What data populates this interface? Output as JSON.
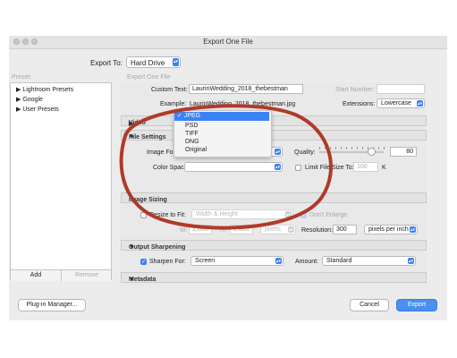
{
  "window": {
    "title": "Export One File"
  },
  "export_to": {
    "label": "Export To:",
    "value": "Hard Drive"
  },
  "presets": {
    "header": "Preset:",
    "items": [
      "Lightroom Presets",
      "Google",
      "User Presets"
    ],
    "add_label": "Add",
    "remove_label": "Remove"
  },
  "export_one_file_header": "Export One File",
  "custom_text": {
    "label": "Custom Text:",
    "value": "LaurinWedding_2018_thebestman"
  },
  "start_number": {
    "label": "Start Number:"
  },
  "example": {
    "label": "Example:",
    "value": "LaurinWedding_2018_thebestman.jpg"
  },
  "extensions": {
    "label": "Extensions:",
    "value": "Lowercase"
  },
  "sections": {
    "video": "Video",
    "file_settings": "File Settings",
    "image_sizing": "Image Sizing",
    "output_sharpening": "Output Sharpening",
    "metadata": "Metadata"
  },
  "file_settings": {
    "image_format_label": "Image Format:",
    "color_space_label": "Color Space:",
    "quality_label": "Quality:",
    "quality_value": "80",
    "quality_fraction": 0.8,
    "limit_file_size_label": "Limit File Size To:",
    "limit_file_size_value": "100",
    "limit_unit": "K"
  },
  "format_menu": {
    "options": [
      "JPEG",
      "PSD",
      "TIFF",
      "DNG",
      "Original"
    ],
    "selected": "JPEG",
    "check_mark": "✓"
  },
  "image_sizing": {
    "resize_label": "Resize to Fit:",
    "resize_value": "Width & Height",
    "dont_enlarge": "Don't Enlarge",
    "w_label": "W:",
    "w_value": "1,000",
    "h_label": "H:",
    "h_value": "1,000",
    "units": "pixels",
    "resolution_label": "Resolution:",
    "resolution_value": "300",
    "resolution_unit": "pixels per inch"
  },
  "output_sharpening": {
    "sharpen_for_label": "Sharpen For:",
    "sharpen_for_value": "Screen",
    "amount_label": "Amount:",
    "amount_value": "Standard"
  },
  "buttons": {
    "plugin_manager": "Plug-in Manager...",
    "cancel": "Cancel",
    "export": "Export"
  },
  "colors": {
    "accent": "#3b82f6",
    "annotation": "#b03a2a"
  }
}
